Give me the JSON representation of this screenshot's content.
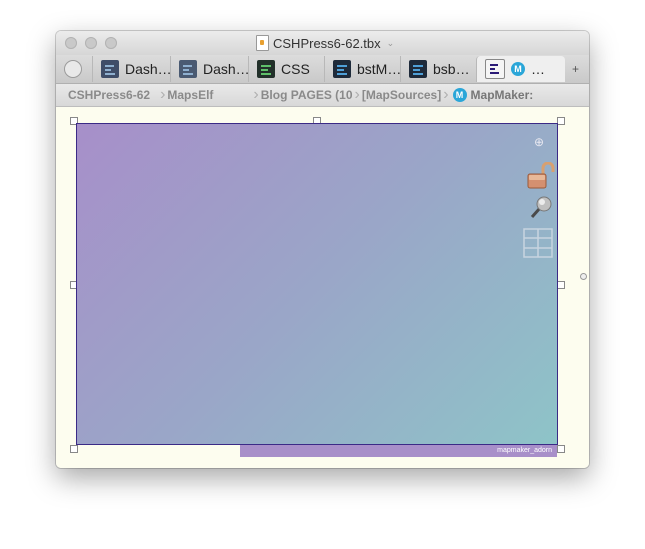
{
  "window": {
    "title": "CSHPress6-62.tbx",
    "title_chevron": "⌄"
  },
  "tabs": [
    {
      "label": "Dash…"
    },
    {
      "label": "Dash…"
    },
    {
      "label": "CSS"
    },
    {
      "label": "bstM…"
    },
    {
      "label": "bsb…"
    },
    {
      "label": "…",
      "active": true
    }
  ],
  "tab_add": "+",
  "breadcrumb": [
    {
      "label": "CSHPress6-62"
    },
    {
      "label": "MapsElf"
    },
    {
      "label": "Blog PAGES (10"
    },
    {
      "label": "[MapSources]"
    },
    {
      "label": "MapMaker:"
    }
  ],
  "badge_letter": "M",
  "map": {
    "adornment_label": "mapmaker_adorn",
    "tools": {
      "zoom": "⊕",
      "lock": "unlocked-padlock-icon",
      "pin": "pushpin-icon",
      "grid": "grid-icon"
    }
  },
  "colors": {
    "map_gradient_start": "#a78fc9",
    "map_gradient_end": "#8ec4c8",
    "map_border": "#3b2a86",
    "canvas_bg": "#fdfdef",
    "adorn_bg": "#a88fc9"
  }
}
